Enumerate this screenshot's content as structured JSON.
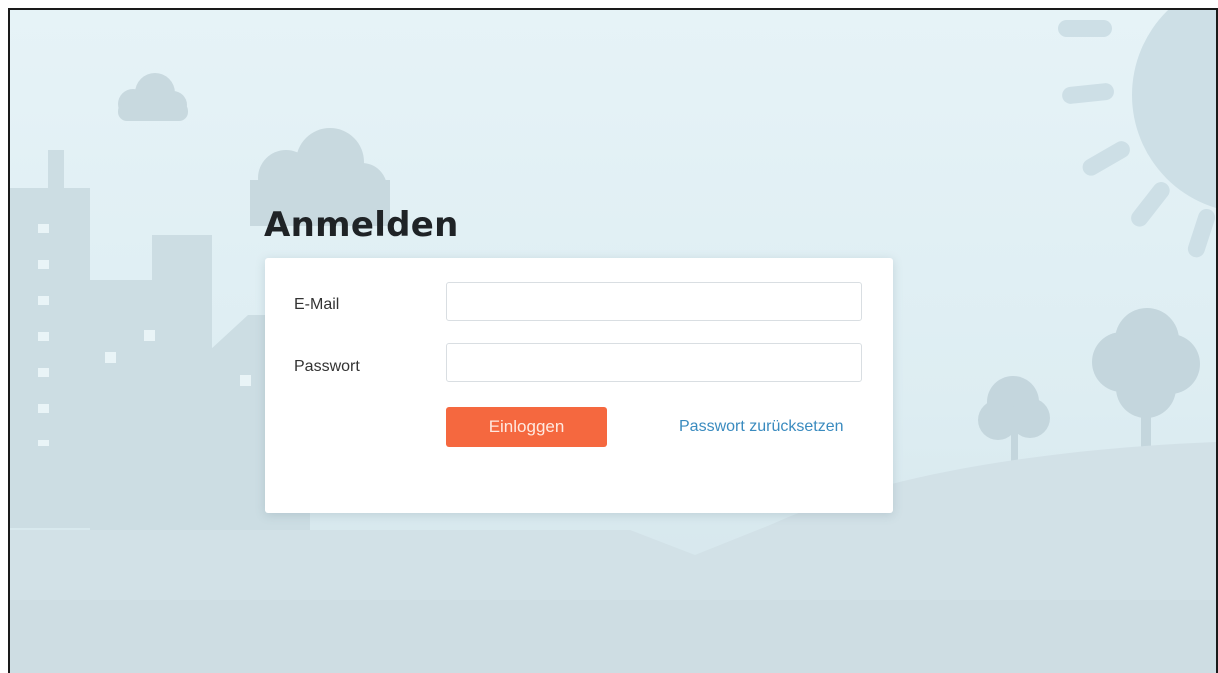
{
  "page": {
    "title": "Anmelden"
  },
  "form": {
    "email_label": "E-Mail",
    "email_value": "",
    "email_placeholder": "",
    "password_label": "Passwort",
    "password_value": "",
    "password_placeholder": "",
    "login_button": "Einloggen",
    "reset_link": "Passwort zurücksetzen"
  },
  "colors": {
    "sky": "#e3f1f5",
    "scenery": "#cfdfe5",
    "accent_button": "#f5683f",
    "link": "#3a8bbf"
  },
  "icons": {
    "background": [
      "sun-icon",
      "cloud-icon",
      "city-skyline",
      "tree-icon",
      "hill"
    ]
  }
}
